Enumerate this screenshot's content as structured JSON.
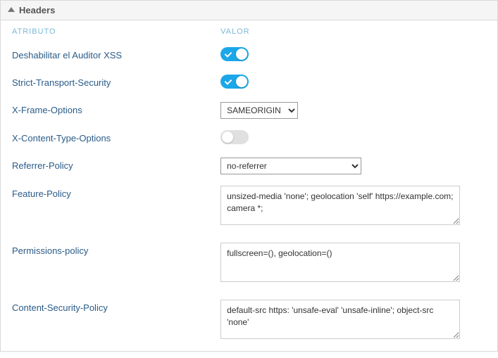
{
  "panel": {
    "title": "Headers",
    "columns": {
      "attribute": "ATRIBUTO",
      "value": "VALOR"
    }
  },
  "rows": {
    "xss": {
      "label": "Deshabilitar el Auditor XSS",
      "state": true
    },
    "hsts": {
      "label": "Strict-Transport-Security",
      "state": true
    },
    "xframe": {
      "label": "X-Frame-Options",
      "selected": "SAMEORIGIN"
    },
    "xcontent": {
      "label": "X-Content-Type-Options",
      "state": false
    },
    "referrer": {
      "label": "Referrer-Policy",
      "selected": "no-referrer"
    },
    "feature": {
      "label": "Feature-Policy",
      "value": "unsized-media 'none'; geolocation 'self' https://example.com; camera *;"
    },
    "permissions": {
      "label": "Permissions-policy",
      "value": "fullscreen=(), geolocation=()"
    },
    "csp": {
      "label": "Content-Security-Policy",
      "value": "default-src https: 'unsafe-eval' 'unsafe-inline'; object-src 'none'"
    }
  }
}
